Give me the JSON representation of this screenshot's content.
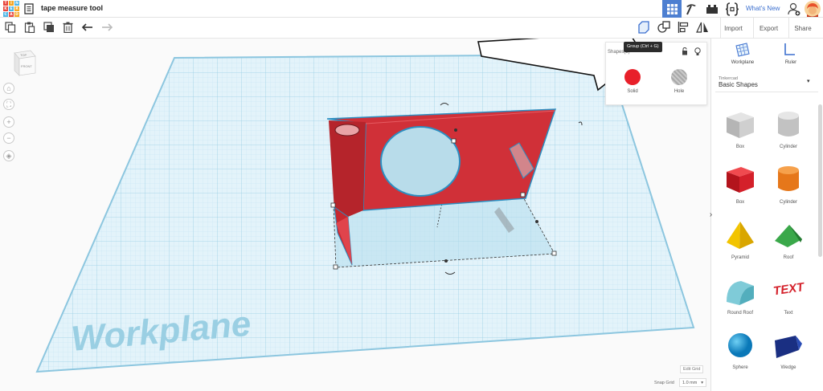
{
  "app": {
    "logo_letters": [
      "T",
      "I",
      "N",
      "K",
      "E",
      "R",
      "C",
      "A",
      "D"
    ],
    "logo_colors": [
      "#e8453c",
      "#f5a623",
      "#4fb5e5",
      "#e8453c",
      "#4fb5e5",
      "#f5a623",
      "#4fb5e5",
      "#e8453c",
      "#f5a623"
    ],
    "title": "tape measure tool",
    "whats_new": "What's New"
  },
  "header": {
    "right_buttons": [
      "Import",
      "Export",
      "Share"
    ]
  },
  "tooltip": {
    "group": "Group (Ctrl + G)"
  },
  "inspector": {
    "heading": "Shapes(3)",
    "solid_label": "Solid",
    "hole_label": "Hole",
    "solid_color": "#e8202a",
    "hole_color": "#bdbdbd"
  },
  "viewcube": {
    "top": "TOP",
    "front": "FRONT"
  },
  "canvas": {
    "workplane_label": "Workplane",
    "edit_grid": "Edit Grid",
    "snap_label": "Snap Grid",
    "snap_value": "1.0 mm"
  },
  "panel": {
    "workplane": "Workplane",
    "ruler": "Ruler",
    "library_sub": "Tinkercad",
    "library_name": "Basic Shapes",
    "shapes": [
      {
        "label": "Box",
        "icon": "box-gray-icon"
      },
      {
        "label": "Cylinder",
        "icon": "cylinder-gray-icon"
      },
      {
        "label": "Box",
        "icon": "box-red-icon"
      },
      {
        "label": "Cylinder",
        "icon": "cylinder-orange-icon"
      },
      {
        "label": "Pyramid",
        "icon": "pyramid-icon"
      },
      {
        "label": "Roof",
        "icon": "roof-icon"
      },
      {
        "label": "Round Roof",
        "icon": "round-roof-icon"
      },
      {
        "label": "Text",
        "icon": "text-shape-icon"
      },
      {
        "label": "Sphere",
        "icon": "sphere-icon"
      },
      {
        "label": "Wedge",
        "icon": "wedge-icon"
      }
    ]
  },
  "colors": {
    "accent": "#4d7fd1",
    "grid": "#a8d8ea",
    "model": "#d5303a"
  }
}
